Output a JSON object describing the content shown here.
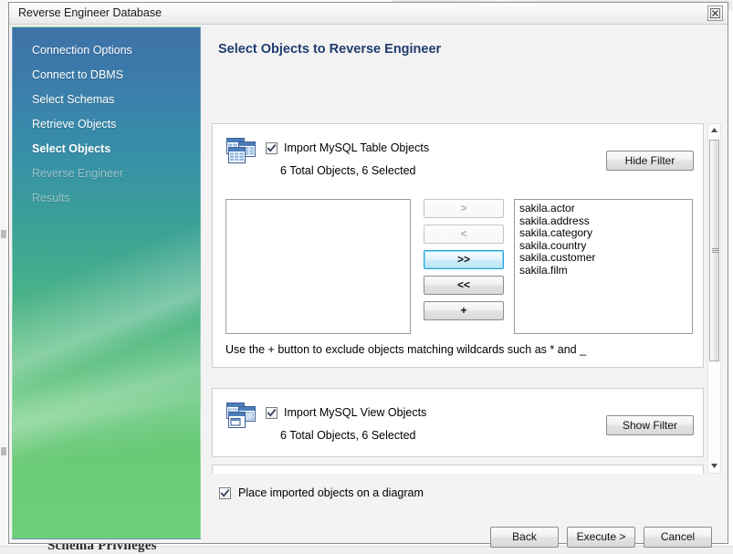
{
  "window": {
    "title": "Reverse Engineer Database",
    "close_icon": "close-icon"
  },
  "background": {
    "behind_window_title": "Schema Privileges"
  },
  "sidebar": {
    "items": [
      {
        "label": "Connection Options",
        "state": "done"
      },
      {
        "label": "Connect to DBMS",
        "state": "done"
      },
      {
        "label": "Select Schemas",
        "state": "done"
      },
      {
        "label": "Retrieve Objects",
        "state": "done"
      },
      {
        "label": "Select Objects",
        "state": "current"
      },
      {
        "label": "Reverse Engineer",
        "state": "disabled"
      },
      {
        "label": "Results",
        "state": "disabled"
      }
    ]
  },
  "content": {
    "title": "Select Objects to Reverse Engineer",
    "panels": [
      {
        "id": "tables",
        "icon": "tables-icon",
        "checkbox_label": "Import MySQL Table Objects",
        "checked": true,
        "count_text": "6 Total Objects, 6 Selected",
        "filter_button": "Hide Filter",
        "filter_expanded": true,
        "exclude_list": [],
        "include_list": [
          "sakila.actor",
          "sakila.address",
          "sakila.category",
          "sakila.country",
          "sakila.customer",
          "sakila.film"
        ],
        "transfer_buttons": [
          {
            "label": ">",
            "state": "disabled"
          },
          {
            "label": "<",
            "state": "disabled"
          },
          {
            "label": ">>",
            "state": "focused"
          },
          {
            "label": "<<",
            "state": "normal"
          },
          {
            "label": "+",
            "state": "normal"
          }
        ],
        "hint": "Use the + button to exclude objects matching wildcards such as * and _"
      },
      {
        "id": "views",
        "icon": "views-icon",
        "checkbox_label": "Import MySQL View Objects",
        "checked": true,
        "count_text": "6 Total Objects, 6 Selected",
        "filter_button": "Show Filter",
        "filter_expanded": false
      }
    ],
    "place_on_diagram": {
      "label": "Place imported objects on a diagram",
      "checked": true
    },
    "actions": [
      {
        "label": "Back"
      },
      {
        "label": "Execute >"
      },
      {
        "label": "Cancel"
      }
    ]
  },
  "scrollbar": {
    "up_icon": "caret-up-icon",
    "down_icon": "caret-down-icon"
  },
  "colors": {
    "sidebar_top": "#3e72a8",
    "sidebar_bottom": "#6fce79",
    "heading": "#1f3d6e",
    "focus_border": "#2aa5d6"
  }
}
